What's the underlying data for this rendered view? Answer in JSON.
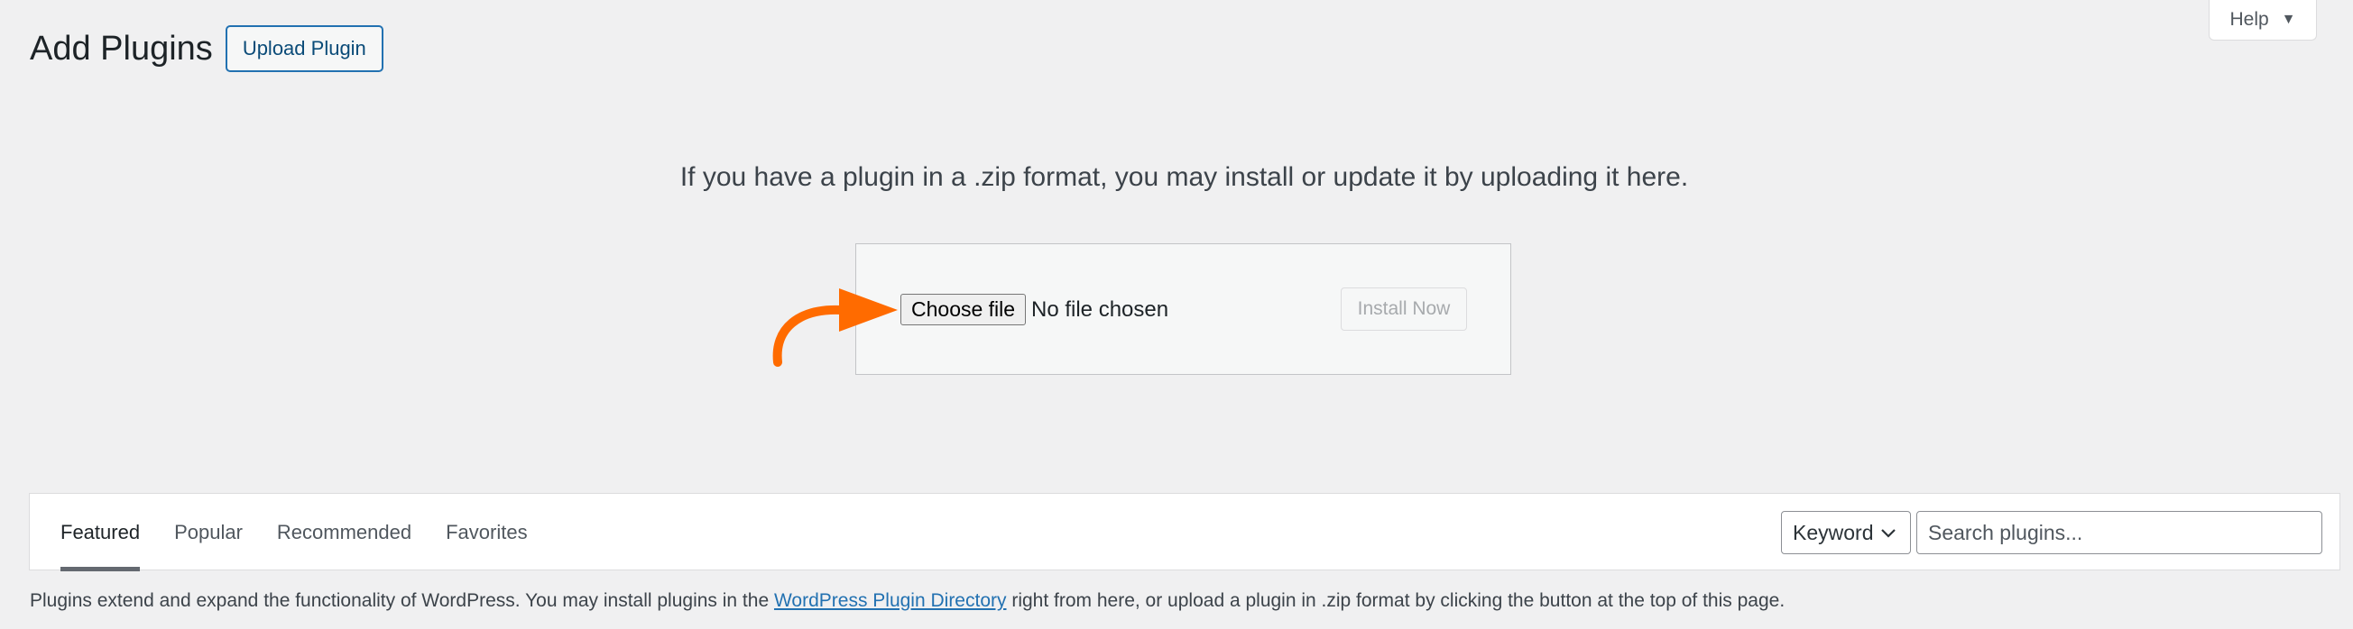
{
  "help": {
    "label": "Help",
    "caret": "▼"
  },
  "header": {
    "title": "Add Plugins",
    "upload_button": "Upload Plugin"
  },
  "upload": {
    "description": "If you have a plugin in a .zip format, you may install or update it by uploading it here.",
    "choose_file_label": "Choose file",
    "file_status": "No file chosen",
    "install_button": "Install Now",
    "annotation_arrow_color": "#ff6b00"
  },
  "filter": {
    "tabs": [
      {
        "label": "Featured",
        "current": true
      },
      {
        "label": "Popular",
        "current": false
      },
      {
        "label": "Recommended",
        "current": false
      },
      {
        "label": "Favorites",
        "current": false
      }
    ],
    "search_type": "Keyword",
    "search_placeholder": "Search plugins..."
  },
  "footer": {
    "text_before": "Plugins extend and expand the functionality of WordPress. You may install plugins in the ",
    "link": "WordPress Plugin Directory",
    "text_after": " right from here, or upload a plugin in .zip format by clicking the button at the top of this page."
  },
  "colors": {
    "accent": "#2271b1",
    "background": "#f0f0f1",
    "arrow": "#ff6b00"
  }
}
